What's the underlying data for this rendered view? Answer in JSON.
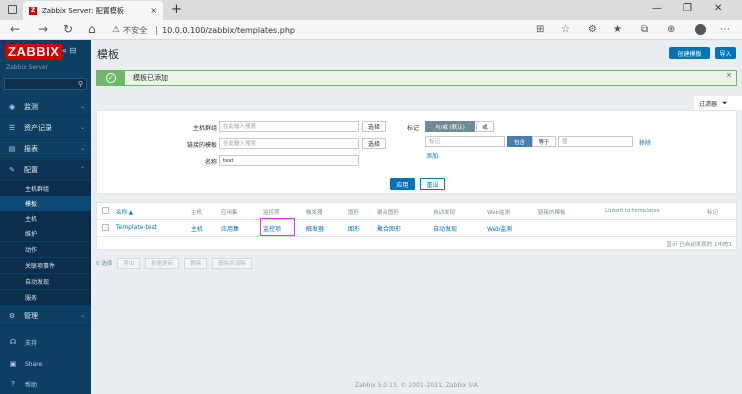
{
  "browser": {
    "tab_title": "Zabbix Server: 配置模板",
    "favicon": "Z",
    "new_tab": "+",
    "insecure_label": "不安全",
    "url": "10.0.0.100/zabbix/templates.php"
  },
  "sidebar": {
    "logo": "ZABBIX",
    "server_name": "Zabbix Server",
    "menu": [
      {
        "label": "监测",
        "icon": "eye-icon"
      },
      {
        "label": "资产记录",
        "icon": "list-icon"
      },
      {
        "label": "报表",
        "icon": "chart-icon"
      },
      {
        "label": "配置",
        "icon": "wrench-icon"
      }
    ],
    "submenu": [
      {
        "label": "主机群组"
      },
      {
        "label": "模板"
      },
      {
        "label": "主机"
      },
      {
        "label": "维护"
      },
      {
        "label": "动作"
      },
      {
        "label": "关联项事件"
      },
      {
        "label": "自动发现"
      },
      {
        "label": "服务"
      }
    ],
    "admin": {
      "label": "管理"
    },
    "bottom": [
      {
        "label": "支持"
      },
      {
        "label": "Share"
      },
      {
        "label": "帮助"
      }
    ]
  },
  "header": {
    "title": "模板",
    "create_button": "创建模板",
    "import_button": "导入"
  },
  "message": {
    "text": "模板已添加"
  },
  "filter": {
    "tab_label": "过滤器",
    "host_groups_label": "主机群组",
    "host_groups_placeholder": "在此输入搜索",
    "linked_templates_label": "链接的模板",
    "linked_templates_placeholder": "在此输入搜索",
    "name_label": "名称",
    "name_value": "test",
    "select_label": "选择",
    "tags_label": "标记",
    "and_or": "与/或 (默认)",
    "or": "或",
    "tag_placeholder": "标记",
    "contains": "包含",
    "equals": "等于",
    "value_placeholder": "值",
    "remove": "移除",
    "add": "添加",
    "apply": "应用",
    "reset": "重设"
  },
  "table": {
    "headers": {
      "name": "名称 ▲",
      "hosts": "主机",
      "applications": "应用集",
      "items": "监控项",
      "triggers": "触发器",
      "graphs": "图形",
      "screens": "聚合图形",
      "discovery": "自动发现",
      "web": "Web监测",
      "linked_templates": "链接的模板",
      "linked_to_templates": "Linked to templates",
      "tags": "标记"
    },
    "row": {
      "name": "Template-test",
      "hosts": "主机",
      "applications": "应用集",
      "items": "监控项",
      "triggers": "触发器",
      "graphs": "图形",
      "screens": "聚合图形",
      "discovery": "自动发现",
      "web": "Web监测"
    },
    "count_text": "显示 已自动发现的 1中的1"
  },
  "actions": {
    "selected": "0 选择",
    "buttons": [
      "导出",
      "批量更新",
      "删除",
      "删除并清除"
    ]
  },
  "footer": "Zabbix 5.0.13. © 2001–2021, Zabbix SIA",
  "colors": {
    "sidebar": "#0f3e63",
    "accent": "#0275b8",
    "success": "#6fb86a",
    "highlight": "#e033e0"
  }
}
